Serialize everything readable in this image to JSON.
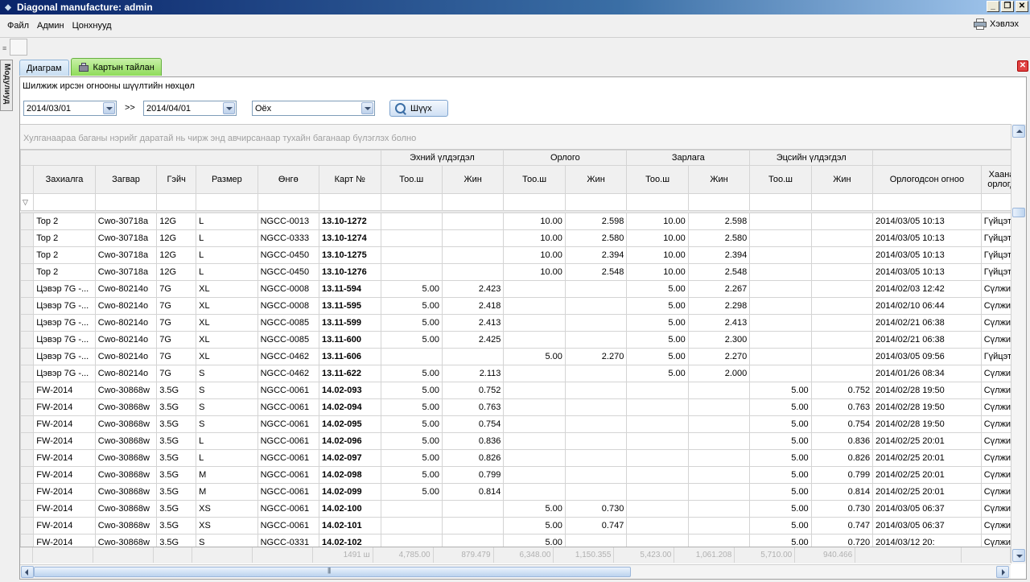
{
  "window": {
    "title": "Diagonal manufacture: admin"
  },
  "menu": {
    "items": [
      "Файл",
      "Админ",
      "Цонхнууд"
    ],
    "help_label": "Хэвлэх"
  },
  "side_panel": {
    "label": "Модулиуд"
  },
  "tabs": [
    {
      "label": "Диаграм",
      "active": false
    },
    {
      "label": "Картын тайлан",
      "active": true
    }
  ],
  "filters": {
    "title": "Шилжиж ирсэн огнооны шүүлтийн нөхцөл",
    "date_from": "2014/03/01",
    "range_sep": ">>",
    "date_to": "2014/04/01",
    "option": "Оёх",
    "search_label": "Шүүх"
  },
  "grid": {
    "group_hint": "Хулганаараа баганы нэрийг даратай нь чирж энд авчирсанаар тухайн баганаар бүлэглэх болно",
    "bands": [
      "Эхний үлдэгдэл",
      "Орлого",
      "Зарлага",
      "Эцсийн үлдэгдэл"
    ],
    "columns": [
      "Захиалга",
      "Загвар",
      "Гэйч",
      "Размер",
      "Өнгө",
      "Карт №",
      "Тоо.ш",
      "Жин",
      "Тоо.ш",
      "Жин",
      "Тоо.ш",
      "Жин",
      "Тоо.ш",
      "Жин",
      "Орлогодсон огноо",
      "Хаанаас орлогдсо"
    ],
    "rows": [
      [
        "Top 2",
        "Cwo-30718a",
        "12G",
        "L",
        "NGCC-0013",
        "13.10-1272",
        "",
        "",
        "10.00",
        "2.598",
        "10.00",
        "2.598",
        "",
        "",
        "2014/03/05 10:13",
        "Гүйцэтгэх"
      ],
      [
        "Top 2",
        "Cwo-30718a",
        "12G",
        "L",
        "NGCC-0333",
        "13.10-1274",
        "",
        "",
        "10.00",
        "2.580",
        "10.00",
        "2.580",
        "",
        "",
        "2014/03/05 10:13",
        "Гүйцэтгэх"
      ],
      [
        "Top 2",
        "Cwo-30718a",
        "12G",
        "L",
        "NGCC-0450",
        "13.10-1275",
        "",
        "",
        "10.00",
        "2.394",
        "10.00",
        "2.394",
        "",
        "",
        "2014/03/05 10:13",
        "Гүйцэтгэх"
      ],
      [
        "Top 2",
        "Cwo-30718a",
        "12G",
        "L",
        "NGCC-0450",
        "13.10-1276",
        "",
        "",
        "10.00",
        "2.548",
        "10.00",
        "2.548",
        "",
        "",
        "2014/03/05 10:13",
        "Гүйцэтгэх"
      ],
      [
        "Цэвэр 7G -...",
        "Cwo-80214o",
        "7G",
        "XL",
        "NGCC-0008",
        "13.11-594",
        "5.00",
        "2.423",
        "",
        "",
        "5.00",
        "2.267",
        "",
        "",
        "2014/02/03 12:42",
        "Сүлжих"
      ],
      [
        "Цэвэр 7G -...",
        "Cwo-80214o",
        "7G",
        "XL",
        "NGCC-0008",
        "13.11-595",
        "5.00",
        "2.418",
        "",
        "",
        "5.00",
        "2.298",
        "",
        "",
        "2014/02/10 06:44",
        "Сүлжих"
      ],
      [
        "Цэвэр 7G -...",
        "Cwo-80214o",
        "7G",
        "XL",
        "NGCC-0085",
        "13.11-599",
        "5.00",
        "2.413",
        "",
        "",
        "5.00",
        "2.413",
        "",
        "",
        "2014/02/21 06:38",
        "Сүлжих"
      ],
      [
        "Цэвэр 7G -...",
        "Cwo-80214o",
        "7G",
        "XL",
        "NGCC-0085",
        "13.11-600",
        "5.00",
        "2.425",
        "",
        "",
        "5.00",
        "2.300",
        "",
        "",
        "2014/02/21 06:38",
        "Сүлжих"
      ],
      [
        "Цэвэр 7G -...",
        "Cwo-80214o",
        "7G",
        "XL",
        "NGCC-0462",
        "13.11-606",
        "",
        "",
        "5.00",
        "2.270",
        "5.00",
        "2.270",
        "",
        "",
        "2014/03/05 09:56",
        "Гүйцэтгэх"
      ],
      [
        "Цэвэр 7G -...",
        "Cwo-80214o",
        "7G",
        "S",
        "NGCC-0462",
        "13.11-622",
        "5.00",
        "2.113",
        "",
        "",
        "5.00",
        "2.000",
        "",
        "",
        "2014/01/26 08:34",
        "Сүлжих"
      ],
      [
        "FW-2014",
        "Cwo-30868w",
        "3.5G",
        "S",
        "NGCC-0061",
        "14.02-093",
        "5.00",
        "0.752",
        "",
        "",
        "",
        "",
        "5.00",
        "0.752",
        "2014/02/28 19:50",
        "Сүлжих"
      ],
      [
        "FW-2014",
        "Cwo-30868w",
        "3.5G",
        "S",
        "NGCC-0061",
        "14.02-094",
        "5.00",
        "0.763",
        "",
        "",
        "",
        "",
        "5.00",
        "0.763",
        "2014/02/28 19:50",
        "Сүлжих"
      ],
      [
        "FW-2014",
        "Cwo-30868w",
        "3.5G",
        "S",
        "NGCC-0061",
        "14.02-095",
        "5.00",
        "0.754",
        "",
        "",
        "",
        "",
        "5.00",
        "0.754",
        "2014/02/28 19:50",
        "Сүлжих"
      ],
      [
        "FW-2014",
        "Cwo-30868w",
        "3.5G",
        "L",
        "NGCC-0061",
        "14.02-096",
        "5.00",
        "0.836",
        "",
        "",
        "",
        "",
        "5.00",
        "0.836",
        "2014/02/25 20:01",
        "Сүлжих"
      ],
      [
        "FW-2014",
        "Cwo-30868w",
        "3.5G",
        "L",
        "NGCC-0061",
        "14.02-097",
        "5.00",
        "0.826",
        "",
        "",
        "",
        "",
        "5.00",
        "0.826",
        "2014/02/25 20:01",
        "Сүлжих"
      ],
      [
        "FW-2014",
        "Cwo-30868w",
        "3.5G",
        "M",
        "NGCC-0061",
        "14.02-098",
        "5.00",
        "0.799",
        "",
        "",
        "",
        "",
        "5.00",
        "0.799",
        "2014/02/25 20:01",
        "Сүлжих"
      ],
      [
        "FW-2014",
        "Cwo-30868w",
        "3.5G",
        "M",
        "NGCC-0061",
        "14.02-099",
        "5.00",
        "0.814",
        "",
        "",
        "",
        "",
        "5.00",
        "0.814",
        "2014/02/25 20:01",
        "Сүлжих"
      ],
      [
        "FW-2014",
        "Cwo-30868w",
        "3.5G",
        "XS",
        "NGCC-0061",
        "14.02-100",
        "",
        "",
        "5.00",
        "0.730",
        "",
        "",
        "5.00",
        "0.730",
        "2014/03/05 06:37",
        "Сүлжих"
      ],
      [
        "FW-2014",
        "Cwo-30868w",
        "3.5G",
        "XS",
        "NGCC-0061",
        "14.02-101",
        "",
        "",
        "5.00",
        "0.747",
        "",
        "",
        "5.00",
        "0.747",
        "2014/03/05 06:37",
        "Сүлжих"
      ],
      [
        "FW-2014",
        "Cwo-30868w",
        "3.5G",
        "S",
        "NGCC-0331",
        "14.02-102",
        "",
        "",
        "5.00",
        "",
        "",
        "",
        "5.00",
        "0.720",
        "2014/03/12 20:",
        "Сүлжих"
      ]
    ],
    "totals": [
      "",
      "",
      "",
      "",
      "",
      "1491 ш",
      "4,785.00",
      "879.479",
      "6,348.00",
      "1,150.355",
      "5,423.00",
      "1,061.208",
      "5,710.00",
      "940.466",
      "",
      ""
    ]
  }
}
